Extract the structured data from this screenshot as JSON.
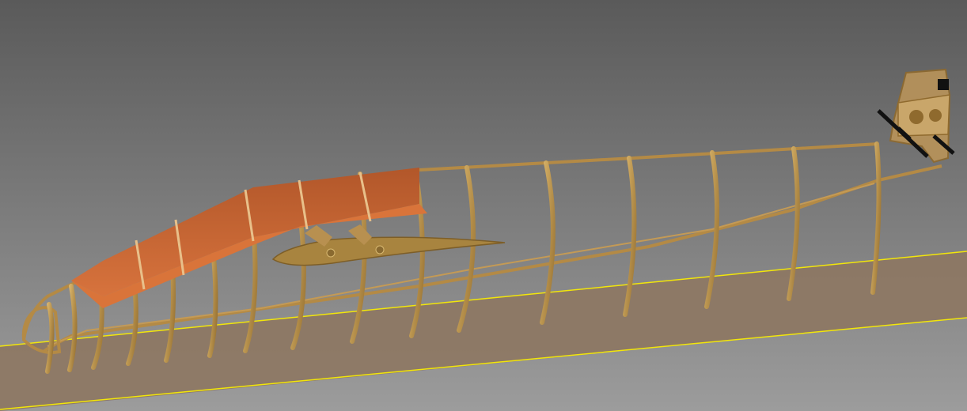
{
  "scene": {
    "colors": {
      "sky_top": "#5a5a5a",
      "sky_bottom": "#9c9c9c",
      "ground_plane": "#8d7763",
      "ground_edge": "#f2e60a",
      "wood_light": "#c9a25c",
      "wood_dark": "#8f6a2e",
      "sheeting": "#c4622f",
      "sheeting_dark": "#9a4a22"
    }
  }
}
